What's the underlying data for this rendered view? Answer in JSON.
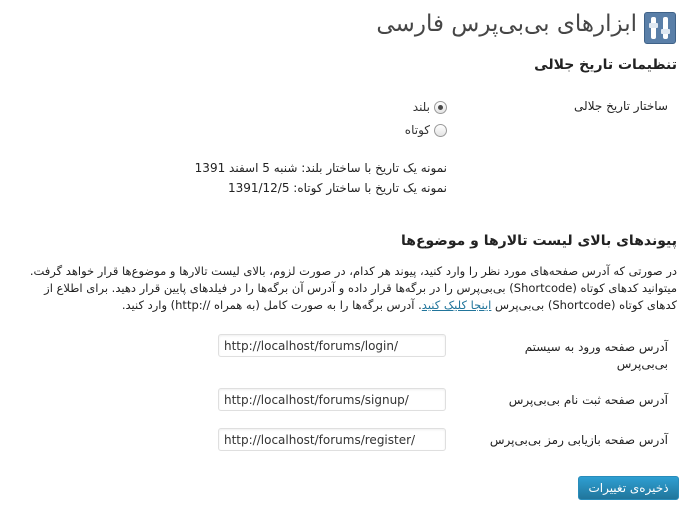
{
  "header": {
    "title": "ابزارهای بی‌بی‌پرس فارسی",
    "icon": "tools-icon"
  },
  "jalali_section": {
    "title": "تنظیمات تاریخ جلالی",
    "format_label": "ساختار تاریخ جلالی",
    "options": [
      {
        "label": "بلند",
        "checked": true
      },
      {
        "label": "کوتاه",
        "checked": false
      }
    ],
    "sample_long": "نمونه یک تاریخ با ساختار بلند: شنبه 5 اسفند 1391",
    "sample_short": "نمونه یک تاریخ با ساختار کوتاه: 1391/12/5"
  },
  "links_section": {
    "title": "پیوندهای بالای لیست تالارها و موضوع‌ها",
    "desc_part1": "در صورتی که آدرس صفحه‌های مورد نظر را وارد کنید، پیوند هر کدام، در صورت لزوم، بالای لیست تالارها و موضوع‌ها قرار خواهد گرفت. میتوانید کدهای کوتاه (Shortcode) بی‌بی‌پرس را در برگه‌ها قرار داده و آدرس آن برگه‌ها را در فیلدهای پایین قرار دهید. برای اطلاع از کدهای کوتاه (Shortcode) بی‌بی‌پرس ",
    "desc_link": "اینجا کلیک کنید",
    "desc_part2": ". آدرس برگه‌ها را به صورت کامل (به همراه //:http) وارد کنید.",
    "fields": [
      {
        "label": "آدرس صفحه ورود به سیستم بی‌بی‌پرس",
        "value": "http://localhost/forums/login/"
      },
      {
        "label": "آدرس صفحه ثبت نام بی‌بی‌پرس",
        "value": "http://localhost/forums/signup/"
      },
      {
        "label": "آدرس صفحه بازیابی رمز بی‌بی‌پرس",
        "value": "http://localhost/forums/register/"
      }
    ]
  },
  "save_button": "ذخیره‌ی تغییرات",
  "colors": {
    "accent": "#21759b",
    "button_top": "#2e9fd2"
  }
}
